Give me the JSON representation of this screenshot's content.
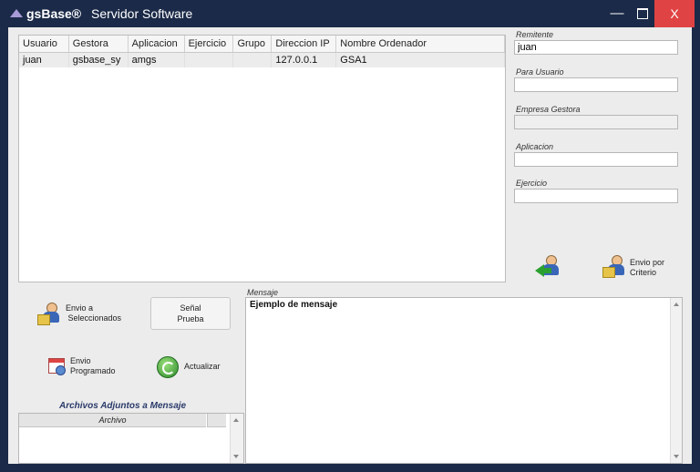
{
  "window": {
    "app_name": "gsBase®",
    "title": "Servidor Software",
    "minimize_label": "—",
    "close_label": "X"
  },
  "sessions_table": {
    "columns": [
      "Usuario",
      "Gestora",
      "Aplicacion",
      "Ejercicio",
      "Grupo",
      "Direccion IP",
      "Nombre Ordenador"
    ],
    "rows": [
      [
        "juan",
        "gsbase_sy",
        "amgs",
        "",
        "",
        "127.0.0.1",
        "GSA1"
      ]
    ]
  },
  "fields": {
    "remitente_label": "Remitente",
    "remitente_value": "juan",
    "para_usuario_label": "Para Usuario",
    "para_usuario_value": "",
    "empresa_gestora_label": "Empresa Gestora",
    "empresa_gestora_value": "",
    "aplicacion_label": "Aplicacion",
    "aplicacion_value": "",
    "ejercicio_label": "Ejercicio",
    "ejercicio_value": ""
  },
  "actions": {
    "envio_criterio_line1": "Envio por",
    "envio_criterio_line2": "Criterio",
    "envio_sel_line1": "Envio a",
    "envio_sel_line2": "Seleccionados",
    "senal_line1": "Señal",
    "senal_line2": "Prueba",
    "programado_line1": "Envio",
    "programado_line2": "Programado",
    "actualizar": "Actualizar"
  },
  "message": {
    "label": "Mensaje",
    "text": "Ejemplo de mensaje"
  },
  "attachments": {
    "title": "Archivos Adjuntos a Mensaje",
    "column": "Archivo"
  },
  "icons": [
    "app-logo-icon",
    "user-arrow-icon",
    "user-folder-icon",
    "calendar-clock-icon",
    "refresh-icon"
  ]
}
